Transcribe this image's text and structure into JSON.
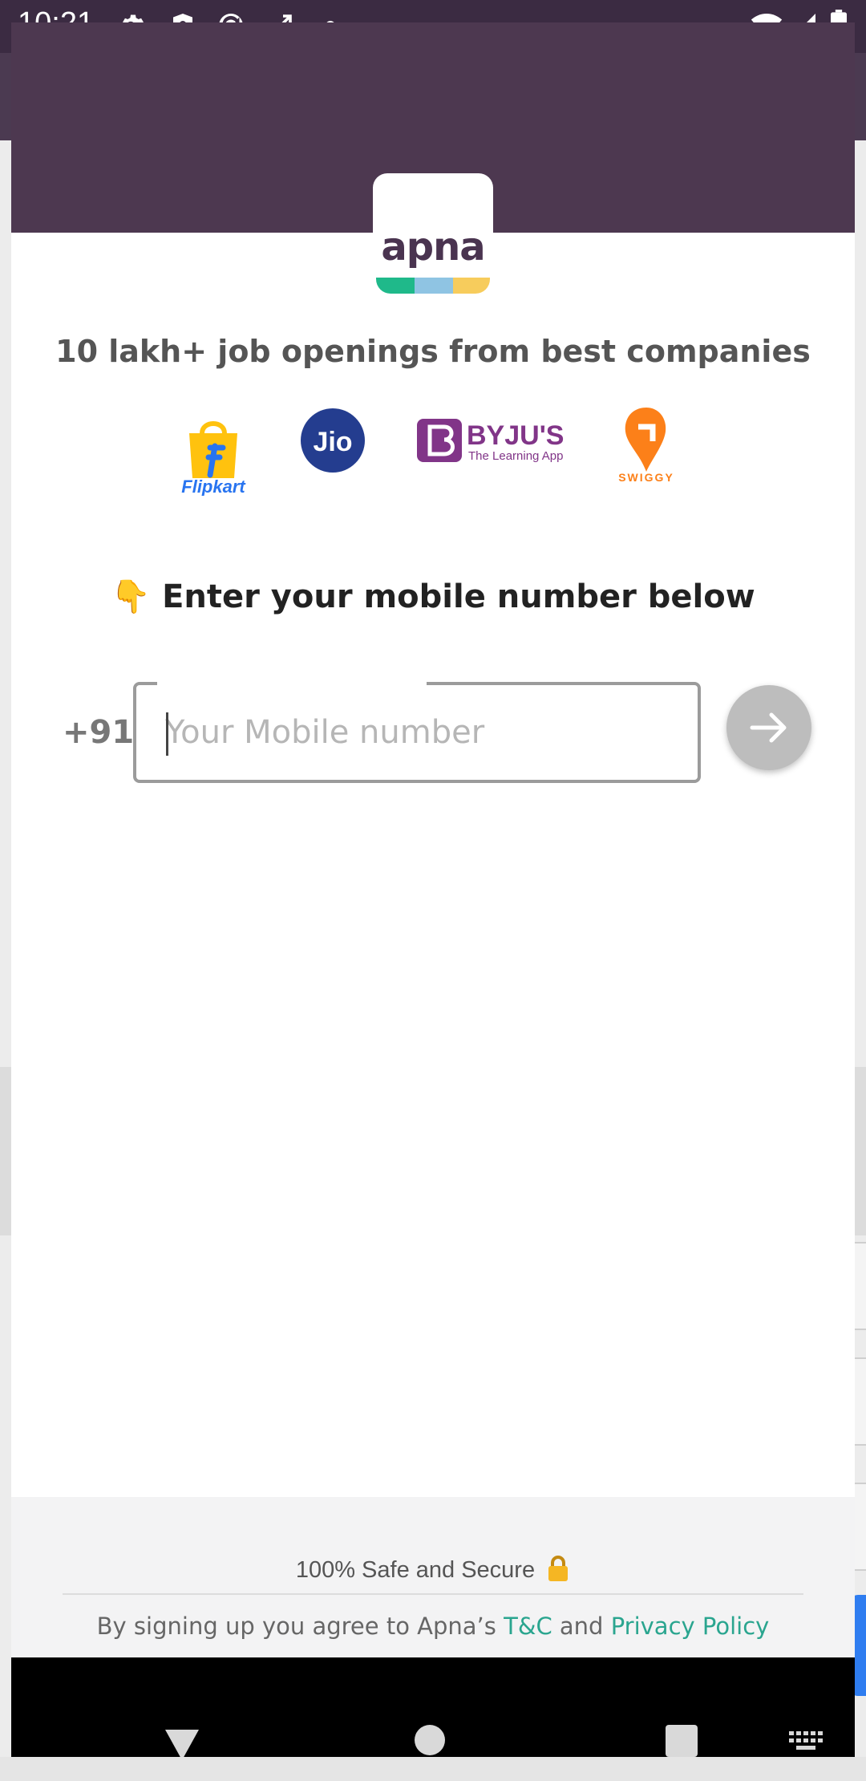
{
  "status_bar": {
    "time": "10:21",
    "icons": [
      "settings-icon",
      "shield-icon",
      "sync-icon",
      "expand-icon",
      "dot-icon",
      "wifi-icon",
      "signal-icon",
      "battery-icon"
    ]
  },
  "brand": {
    "logo_text": "apna",
    "colors": {
      "header": "#4d3850",
      "green": "#1fb98a",
      "blue": "#8fc4e3",
      "yellow": "#f7cc5c",
      "link": "#2aa58f"
    }
  },
  "headline": "10 lakh+ job openings from best companies",
  "companies": [
    {
      "name": "Flipkart",
      "icon": "flipkart-logo"
    },
    {
      "name": "Jio",
      "icon": "jio-logo"
    },
    {
      "name": "BYJU'S",
      "tagline": "The Learning App",
      "icon": "byjus-logo"
    },
    {
      "name": "SWIGGY",
      "icon": "swiggy-logo"
    }
  ],
  "prompt": {
    "emoji": "👇",
    "text": "Enter your mobile number below"
  },
  "mobile": {
    "country_code": "+91",
    "placeholder": "Your Mobile number",
    "value": ""
  },
  "footer": {
    "secure_text": "100% Safe and Secure",
    "terms_prefix": "By signing up you agree to Apna’s",
    "terms_link": "T&C",
    "terms_and": "and",
    "privacy_link": "Privacy Policy"
  },
  "navigation": [
    "back-icon",
    "home-icon",
    "recents-icon",
    "keyboard-icon"
  ]
}
